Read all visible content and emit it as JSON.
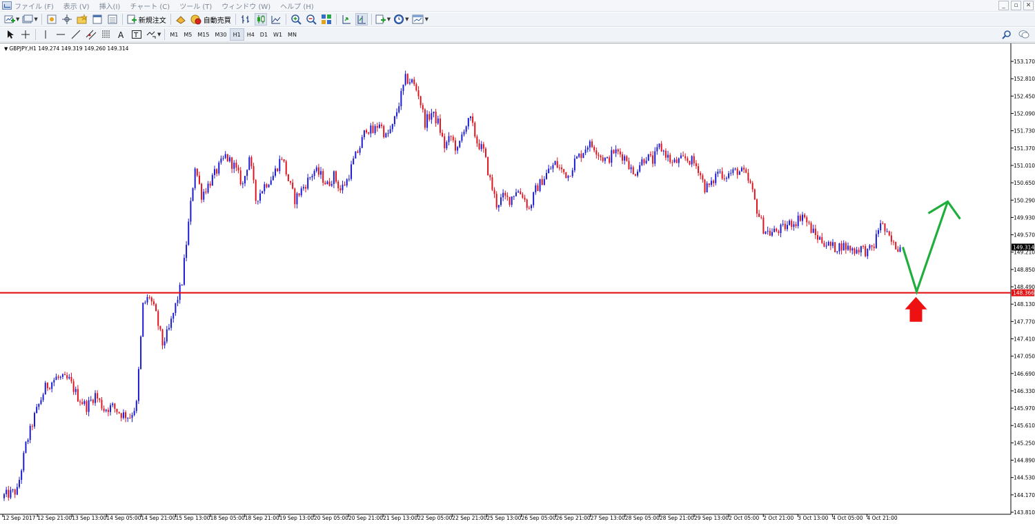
{
  "menu": {
    "items": [
      "ファイル (F)",
      "表示 (V)",
      "挿入(I)",
      "チャート (C)",
      "ツール (T)",
      "ウィンドウ (W)",
      "ヘルプ (H)"
    ]
  },
  "toolbar": {
    "new_order_label": "新規注文",
    "auto_trade_label": "自動売買",
    "timeframes": [
      "M1",
      "M5",
      "M15",
      "M30",
      "H1",
      "H4",
      "D1",
      "W1",
      "MN"
    ],
    "active_timeframe": "H1"
  },
  "chart_header": {
    "symbol_text": "GBPJPY,H1  149.274 149.319 149.260 149.314"
  },
  "colors": {
    "bull": "#1b1bd4",
    "bear": "#e0121e",
    "support_line": "#e01414",
    "arrow_green": "#1fae3c",
    "arrow_red": "#ee1111"
  },
  "chart_data": {
    "type": "candlestick",
    "symbol": "GBPJPY",
    "timeframe": "H1",
    "ylim": [
      143.81,
      153.4
    ],
    "y_ticks": [
      "153.170",
      "152.810",
      "152.450",
      "152.090",
      "151.730",
      "151.370",
      "151.010",
      "150.650",
      "150.290",
      "149.930",
      "149.570",
      "149.210",
      "148.850",
      "148.490",
      "148.130",
      "147.770",
      "147.410",
      "147.050",
      "146.690",
      "146.330",
      "145.970",
      "145.610",
      "145.250",
      "144.890",
      "144.530",
      "144.170",
      "143.810"
    ],
    "x_ticks": [
      "12 Sep 2017",
      "12 Sep 21:00",
      "13 Sep 13:00",
      "14 Sep 05:00",
      "14 Sep 21:00",
      "15 Sep 13:00",
      "18 Sep 05:00",
      "18 Sep 21:00",
      "19 Sep 13:00",
      "20 Sep 05:00",
      "20 Sep 21:00",
      "21 Sep 13:00",
      "22 Sep 05:00",
      "22 Sep 21:00",
      "25 Sep 13:00",
      "26 Sep 05:00",
      "26 Sep 21:00",
      "27 Sep 13:00",
      "28 Sep 05:00",
      "28 Sep 21:00",
      "29 Sep 13:00",
      "2 Oct 05:00",
      "2 Oct 21:00",
      "3 Oct 13:00",
      "4 Oct 05:00",
      "4 Oct 21:00"
    ],
    "current_price_label": "149.314",
    "current_price": 149.314,
    "support_price_label": "148.366",
    "support_price": 148.366,
    "path_points": [
      [
        0,
        144.15
      ],
      [
        6,
        144.25
      ],
      [
        10,
        145.2
      ],
      [
        14,
        145.8
      ],
      [
        19,
        146.4
      ],
      [
        24,
        146.6
      ],
      [
        30,
        146.55
      ],
      [
        34,
        146.2
      ],
      [
        38,
        146.0
      ],
      [
        42,
        146.25
      ],
      [
        46,
        145.95
      ],
      [
        50,
        146.0
      ],
      [
        54,
        145.85
      ],
      [
        58,
        145.8
      ],
      [
        61,
        146.05
      ],
      [
        64,
        148.1
      ],
      [
        67,
        148.3
      ],
      [
        70,
        147.9
      ],
      [
        73,
        147.3
      ],
      [
        76,
        147.6
      ],
      [
        79,
        148.1
      ],
      [
        82,
        148.6
      ],
      [
        85,
        149.8
      ],
      [
        88,
        151.0
      ],
      [
        91,
        150.4
      ],
      [
        94,
        150.6
      ],
      [
        98,
        150.9
      ],
      [
        102,
        151.2
      ],
      [
        106,
        151.0
      ],
      [
        110,
        150.6
      ],
      [
        113,
        151.2
      ],
      [
        116,
        150.3
      ],
      [
        120,
        150.6
      ],
      [
        124,
        150.8
      ],
      [
        128,
        151.2
      ],
      [
        131,
        150.7
      ],
      [
        134,
        150.3
      ],
      [
        137,
        150.5
      ],
      [
        140,
        150.7
      ],
      [
        143,
        150.9
      ],
      [
        146,
        150.8
      ],
      [
        149,
        150.6
      ],
      [
        152,
        150.8
      ],
      [
        155,
        150.5
      ],
      [
        158,
        150.7
      ],
      [
        161,
        151.1
      ],
      [
        164,
        151.4
      ],
      [
        167,
        151.8
      ],
      [
        170,
        151.7
      ],
      [
        173,
        151.9
      ],
      [
        176,
        151.6
      ],
      [
        179,
        151.8
      ],
      [
        182,
        152.3
      ],
      [
        185,
        152.8
      ],
      [
        188,
        152.75
      ],
      [
        191,
        152.5
      ],
      [
        194,
        151.9
      ],
      [
        197,
        152.1
      ],
      [
        200,
        151.9
      ],
      [
        203,
        151.4
      ],
      [
        206,
        151.6
      ],
      [
        209,
        151.3
      ],
      [
        212,
        151.8
      ],
      [
        215,
        151.95
      ],
      [
        218,
        151.5
      ],
      [
        221,
        151.3
      ],
      [
        224,
        150.7
      ],
      [
        227,
        150.2
      ],
      [
        230,
        150.35
      ],
      [
        233,
        150.3
      ],
      [
        236,
        150.5
      ],
      [
        239,
        150.4
      ],
      [
        242,
        150.1
      ],
      [
        245,
        150.5
      ],
      [
        248,
        150.7
      ],
      [
        251,
        150.9
      ],
      [
        254,
        151.05
      ],
      [
        257,
        150.9
      ],
      [
        260,
        150.8
      ],
      [
        263,
        151.1
      ],
      [
        266,
        151.25
      ],
      [
        269,
        151.45
      ],
      [
        272,
        151.4
      ],
      [
        275,
        151.2
      ],
      [
        278,
        151.1
      ],
      [
        281,
        151.3
      ],
      [
        284,
        151.25
      ],
      [
        287,
        151.15
      ],
      [
        290,
        150.8
      ],
      [
        293,
        151.05
      ],
      [
        296,
        151.2
      ],
      [
        299,
        151.1
      ],
      [
        302,
        151.4
      ],
      [
        305,
        151.25
      ],
      [
        308,
        151.05
      ],
      [
        311,
        151.1
      ],
      [
        314,
        151.15
      ],
      [
        317,
        151.1
      ],
      [
        320,
        150.95
      ],
      [
        323,
        150.55
      ],
      [
        326,
        150.6
      ],
      [
        329,
        150.9
      ],
      [
        332,
        150.8
      ],
      [
        335,
        150.85
      ],
      [
        338,
        150.9
      ],
      [
        341,
        150.85
      ],
      [
        344,
        150.6
      ],
      [
        347,
        150.1
      ],
      [
        350,
        149.7
      ],
      [
        353,
        149.6
      ],
      [
        356,
        149.65
      ],
      [
        359,
        149.7
      ],
      [
        362,
        149.8
      ],
      [
        365,
        149.85
      ],
      [
        368,
        150.0
      ],
      [
        371,
        149.75
      ],
      [
        374,
        149.55
      ],
      [
        377,
        149.45
      ],
      [
        380,
        149.35
      ],
      [
        383,
        149.3
      ],
      [
        386,
        149.35
      ],
      [
        389,
        149.3
      ],
      [
        392,
        149.25
      ],
      [
        395,
        149.3
      ],
      [
        398,
        149.2
      ],
      [
        401,
        149.35
      ],
      [
        404,
        149.85
      ],
      [
        407,
        149.55
      ],
      [
        410,
        149.35
      ],
      [
        413,
        149.31
      ]
    ],
    "projection": {
      "dip_to": 148.39,
      "rise_to": 150.26,
      "pullback_to": 149.9
    }
  }
}
